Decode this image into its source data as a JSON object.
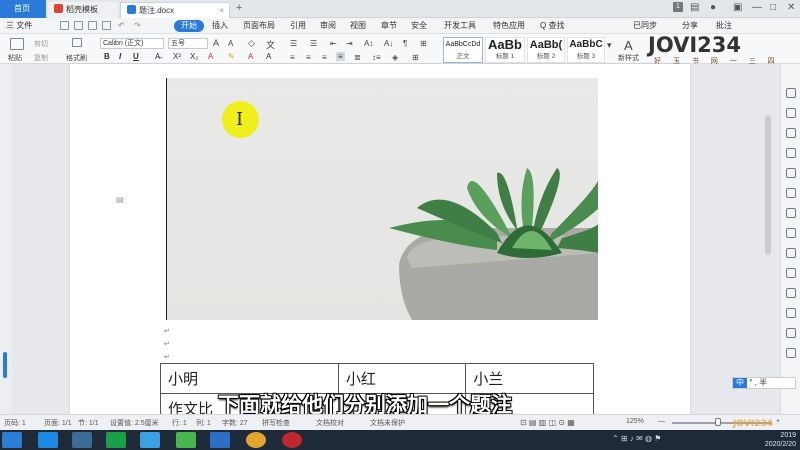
{
  "titlebar": {
    "tabs": [
      {
        "label": "首页"
      },
      {
        "label": "稻壳模板"
      },
      {
        "label": "题注.docx"
      }
    ],
    "right_badge": "1"
  },
  "menubar": {
    "file_label": "三 文件",
    "items": [
      "开始",
      "插入",
      "页面布局",
      "引用",
      "审阅",
      "视图",
      "章节",
      "安全",
      "开发工具",
      "特色应用"
    ],
    "search_label": "Q 查找",
    "sync_label": "已同步",
    "share_label": "分享",
    "comment_label": "批注"
  },
  "ribbon": {
    "paste_label": "粘贴",
    "cut_label": "剪切",
    "copy_label": "复制",
    "format_painter_label": "格式刷",
    "font_name": "Calibri (正文)",
    "font_size": "五号",
    "bold": "B",
    "italic": "I",
    "underline": "U",
    "styles": [
      {
        "sample": "AaBbCcDd",
        "name": "正文"
      },
      {
        "sample": "AaBb",
        "name": "标题 1"
      },
      {
        "sample": "AaBb(",
        "name": "标题 2"
      },
      {
        "sample": "AaBbC",
        "name": "标题 3"
      }
    ],
    "new_style_label": "新样式"
  },
  "logo": {
    "text": "JOVI234",
    "sub": "好 玉 书 网 一 三 四"
  },
  "document": {
    "table_row1": [
      "小明",
      "小红",
      "小兰"
    ],
    "table_row2_first": "作文比"
  },
  "subtitle": "下面就给他们分别添加一个题注",
  "ime": {
    "lang": "中",
    "mode": "° , 半"
  },
  "statusbar": {
    "page": "页码: 1",
    "pages": "页面: 1/1",
    "section": "节: 1/1",
    "settings": "设置值: 2.5厘米",
    "row": "行: 1",
    "col": "列: 1",
    "wordcount": "字数: 27",
    "spellcheck": "拼写检查",
    "proofread": "文档校对",
    "protect": "文档未保护",
    "zoom": "125%"
  },
  "taskbar": {
    "date": "2020/2/20",
    "year": "2019"
  },
  "colors": {
    "accent": "#2b79d8",
    "cursor_highlight": "#eef004",
    "taskbar": "#1f2a38"
  }
}
